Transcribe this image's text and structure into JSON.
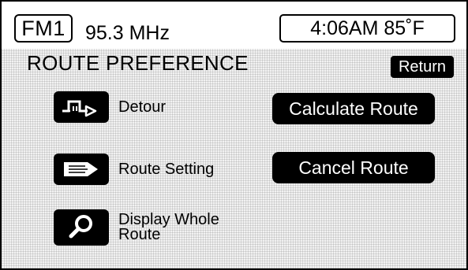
{
  "header": {
    "band": "FM1",
    "frequency": "95.3 MHz",
    "time_temp": "4:06AM 85˚F"
  },
  "page": {
    "title": "ROUTE PREFERENCE",
    "return_label": "Return"
  },
  "options": {
    "detour": {
      "label": "Detour",
      "icon": "detour-icon"
    },
    "route_setting": {
      "label": "Route Setting",
      "icon": "route-setting-arrow-icon"
    },
    "display_whole_route": {
      "label": "Display Whole Route",
      "icon": "magnifier-icon"
    }
  },
  "actions": {
    "calculate": "Calculate Route",
    "cancel": "Cancel Route"
  }
}
